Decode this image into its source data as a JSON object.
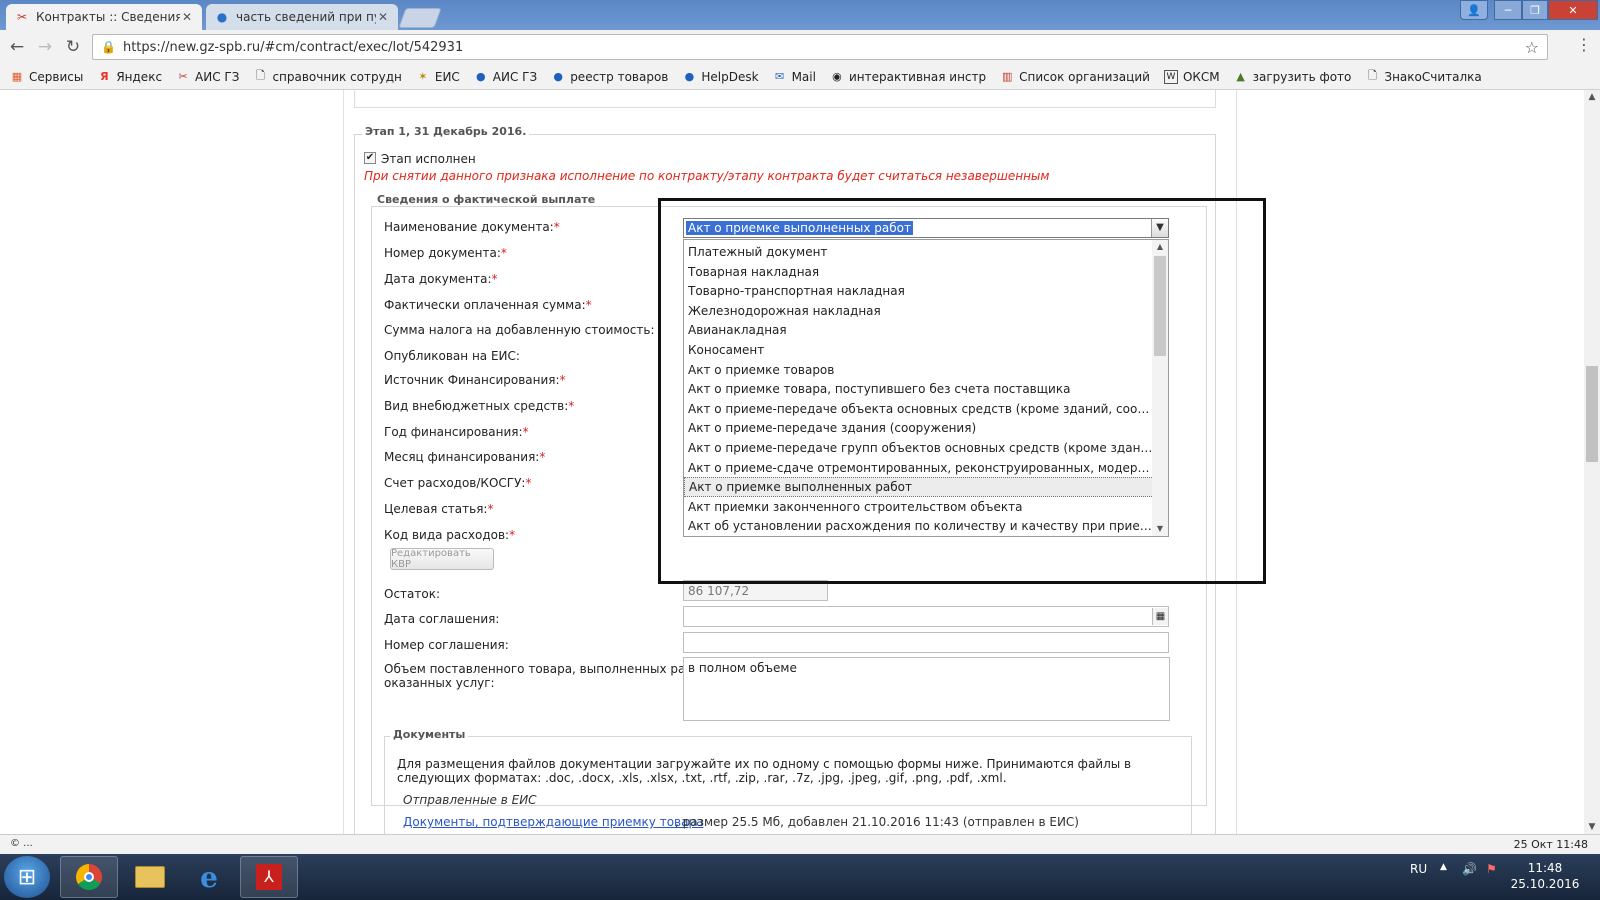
{
  "browser": {
    "tabs": [
      {
        "title": "Контракты :: Сведения о",
        "close": "✕"
      },
      {
        "title": "часть сведений при пуб",
        "close": "✕"
      }
    ],
    "url": "https://new.gz-spb.ru/#cm/contract/exec/lot/542931",
    "bookmarks": [
      {
        "label": "Сервисы",
        "icon": "apps-grid-icon"
      },
      {
        "label": "Яндекс",
        "icon": "yandex-icon"
      },
      {
        "label": "АИС ГЗ",
        "icon": "tool-icon"
      },
      {
        "label": "справочник сотрудн",
        "icon": "page-icon"
      },
      {
        "label": "ЕИС",
        "icon": "emblem-icon"
      },
      {
        "label": "АИС ГЗ",
        "icon": "globe-icon"
      },
      {
        "label": "реестр товаров",
        "icon": "globe-icon"
      },
      {
        "label": "HelpDesk",
        "icon": "globe-icon"
      },
      {
        "label": "Mail",
        "icon": "mail-icon"
      },
      {
        "label": "интерактивная инстр",
        "icon": "github-icon"
      },
      {
        "label": "Список организаций",
        "icon": "chart-icon"
      },
      {
        "label": "ОКСМ",
        "icon": "wiki-icon"
      },
      {
        "label": "загрузить фото",
        "icon": "photo-icon"
      },
      {
        "label": "ЗнакоСчиталка",
        "icon": "page-icon"
      }
    ]
  },
  "stage": {
    "legend": "Этап 1, 31 Декабрь 2016.",
    "done_label": "Этап исполнен",
    "warning": "При снятии данного признака исполнение по контракту/этапу контракта будет считаться незавершенным",
    "payment_legend": "Сведения о фактической выплате"
  },
  "form": {
    "doc_name": "Наименование документа:",
    "doc_number": "Номер документа:",
    "doc_date": "Дата документа:",
    "paid_sum": "Фактически оплаченная сумма:",
    "vat_sum": "Сумма налога на добавленную стоимость:",
    "published": "Опубликован на ЕИС:",
    "fin_source": "Источник Финансирования:",
    "offbudget": "Вид внебюджетных средств:",
    "fin_year": "Год финансирования:",
    "fin_month": "Месяц финансирования:",
    "account": "Счет расходов/КОСГУ:",
    "target": "Целевая статья:",
    "expense_code": "Код вида расходов:",
    "edit_kvr": "Редактировать КВР",
    "remainder": "Остаток:",
    "remainder_value": "86 107,72",
    "agreement_date": "Дата соглашения:",
    "agreement_number": "Номер соглашения:",
    "volume_label_1": "Объем поставленного товара, выполненных работ,",
    "volume_label_2": "оказанных услуг:",
    "volume_value": "в полном объеме",
    "required_mark": "*"
  },
  "dropdown": {
    "selected": "Акт о приемке выполненных работ",
    "options": [
      "Платежный документ",
      "Товарная накладная",
      "Товарно-транспортная накладная",
      "Железнодорожная накладная",
      "Авианакладная",
      "Коносамент",
      "Акт о приемке товаров",
      "Акт о приемке товара, поступившего без счета поставщика",
      "Акт о приеме-передаче объекта основных средств (кроме зданий, сооружений)",
      "Акт о приеме-передаче здания (сооружения)",
      "Акт о приеме-передаче групп объектов основных средств (кроме зданий, соору...",
      "Акт о приеме-сдаче отремонтированных, реконструированных, модернизирован...",
      "Акт о приемке выполненных работ",
      "Акт приемки законченного строительством объекта",
      "Акт об установлении расхождения по количеству и качеству при приемке товар..."
    ],
    "hovered_index": 12
  },
  "documents": {
    "legend": "Документы",
    "text": "Для размещения файлов документации загружайте их по одному с помощью формы ниже. Принимаются файлы в следующих форматах: .doc, .docx, .xls, .xlsx, .txt, .rtf, .zip, .rar, .7z, .jpg, .jpeg, .gif, .png, .pdf, .xml.",
    "sent_label": "Отправленные в ЕИС",
    "link": "Документы, подтверждающие приемку товара",
    "meta": ", размер 25.5 Мб, добавлен 21.10.2016 11:43 (отправлен в ЕИС)"
  },
  "statusbar": {
    "left": "© ...",
    "right": "25 Окт 11:48"
  },
  "taskbar": {
    "lang": "RU",
    "time": "11:48",
    "date": "25.10.2016"
  }
}
